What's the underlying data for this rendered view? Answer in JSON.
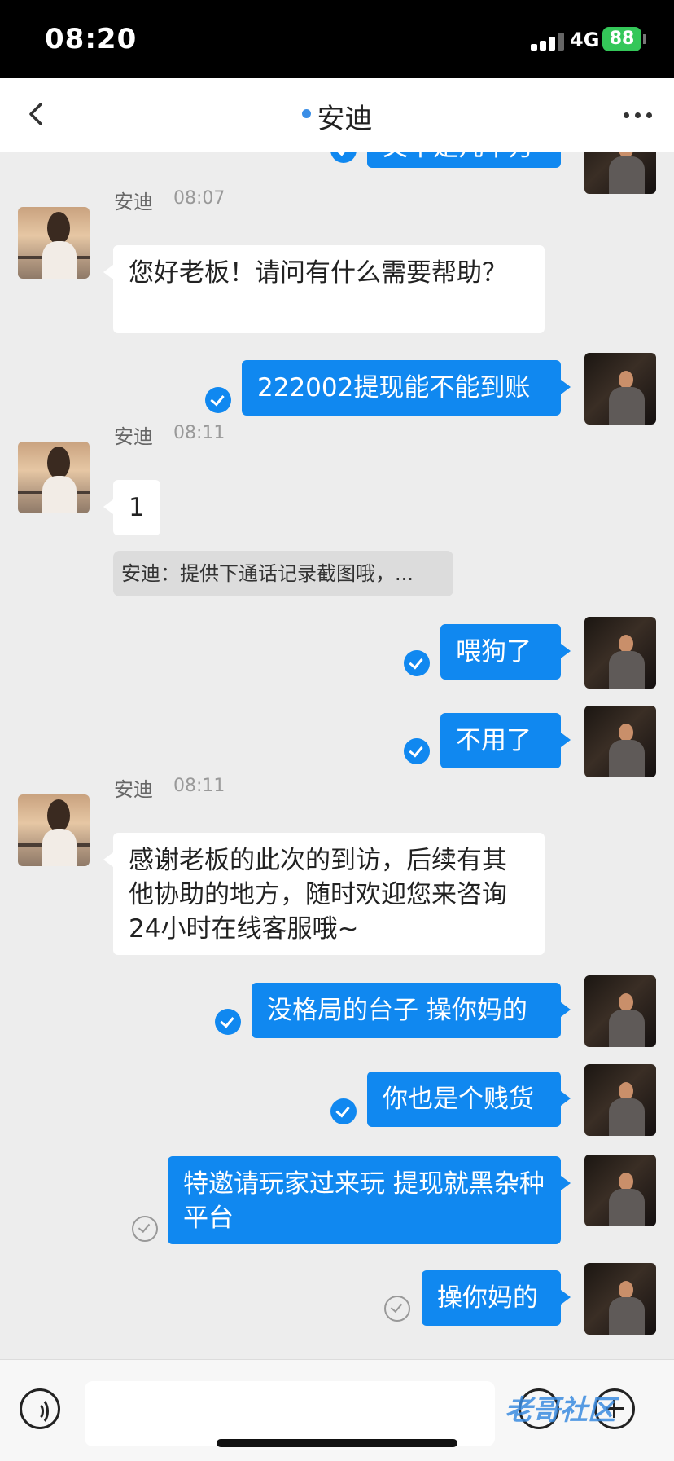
{
  "status_bar": {
    "time": "08:20",
    "network": "4G",
    "battery": "88"
  },
  "nav": {
    "title": "安迪"
  },
  "partial_top": {
    "text": "又不是几十万"
  },
  "messages": [
    {
      "sender": "安迪",
      "time": "08:07",
      "text": "您好老板！请问有什么需要帮助？",
      "read": null
    },
    {
      "sender": "me",
      "text": "222002提现能不能到账",
      "read": true
    },
    {
      "sender": "安迪",
      "time": "08:11",
      "text": "1",
      "quote": "安迪：提供下通话记录截图哦，..."
    },
    {
      "sender": "me",
      "text": "喂狗了",
      "read": true
    },
    {
      "sender": "me",
      "text": "不用了",
      "read": true
    },
    {
      "sender": "安迪",
      "time": "08:11",
      "text": "感谢老板的此次的到访，后续有其他协助的地方，随时欢迎您来咨询24小时在线客服哦~"
    },
    {
      "sender": "me",
      "text": "没格局的台子 操你妈的",
      "read": true
    },
    {
      "sender": "me",
      "text": "你也是个贱货",
      "read": true
    },
    {
      "sender": "me",
      "text": "特邀请玩家过来玩 提现就黑杂种平台",
      "read": false
    },
    {
      "sender": "me",
      "text": "操你妈的",
      "read": false
    }
  ],
  "input": {
    "placeholder": ""
  },
  "watermark": "老哥社区",
  "colors": {
    "bubble_out": "#1088f0",
    "bubble_in": "#ffffff",
    "background": "#ededed",
    "accent": "#3a8ee6"
  }
}
